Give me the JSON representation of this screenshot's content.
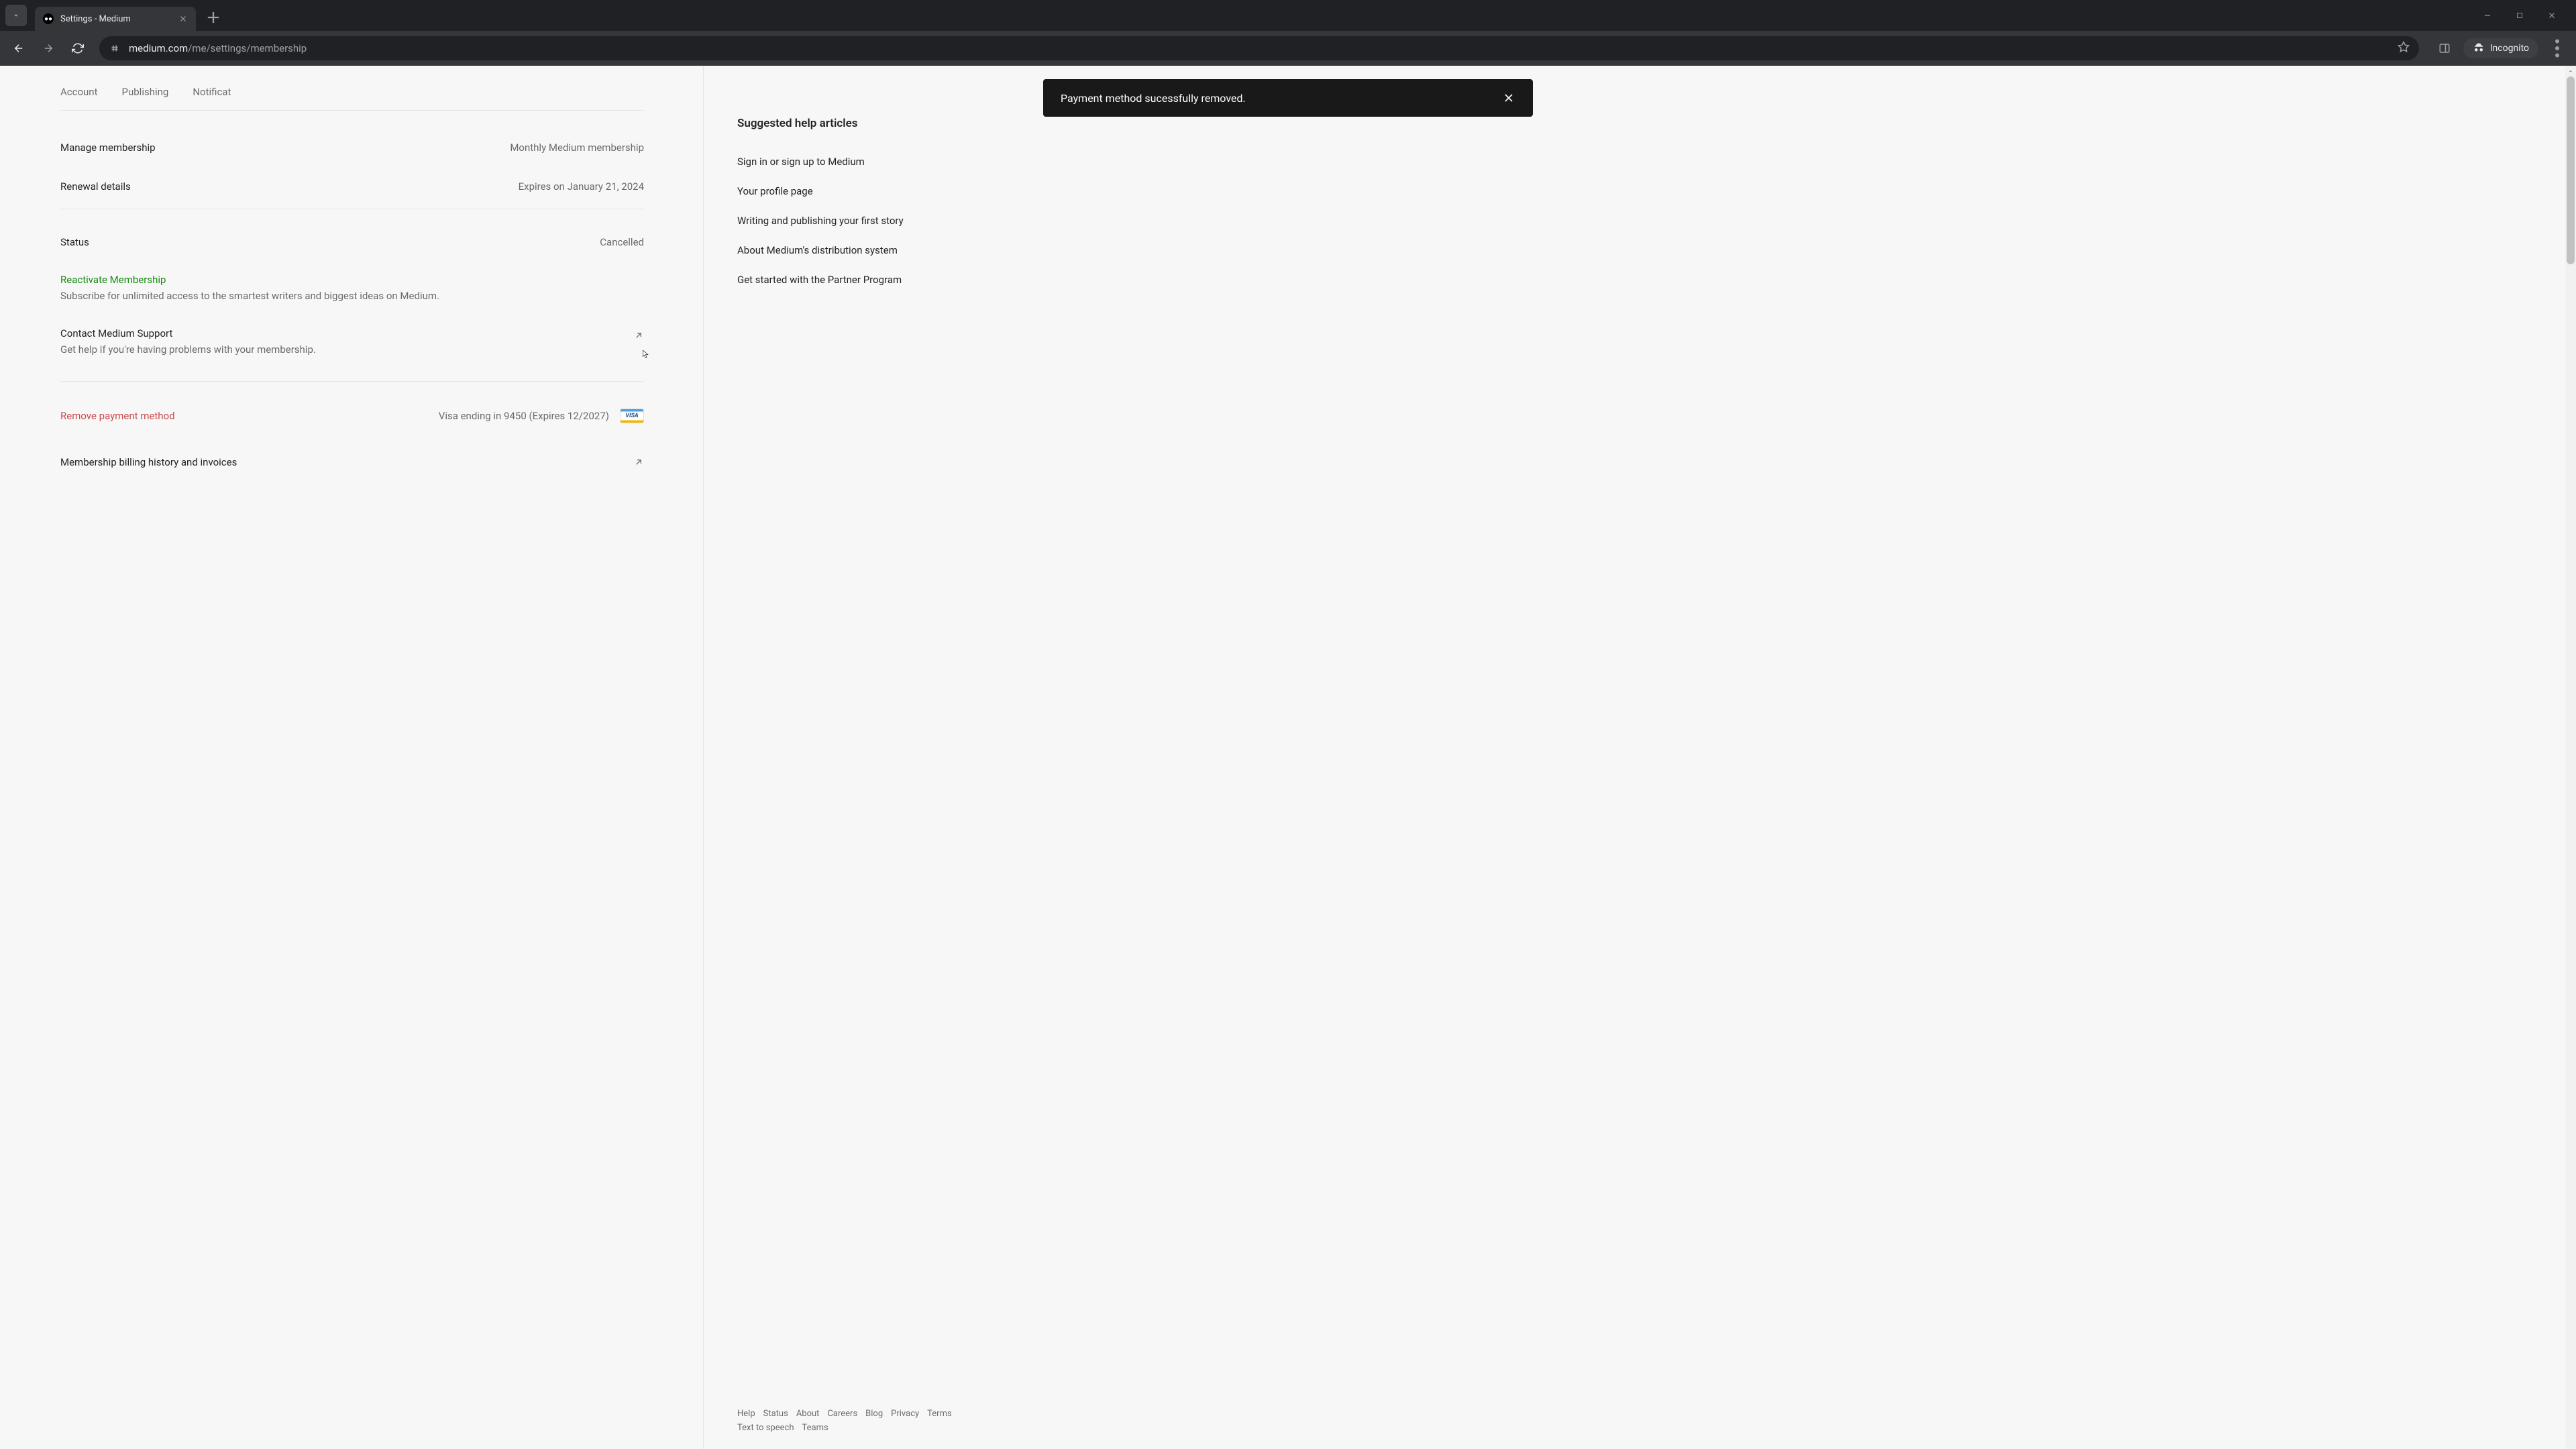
{
  "browser": {
    "tab_title": "Settings - Medium",
    "url_domain": "medium.com",
    "url_path": "/me/settings/membership",
    "incognito_label": "Incognito"
  },
  "toast": {
    "message": "Payment method sucessfully removed."
  },
  "tabs": {
    "account": "Account",
    "publishing": "Publishing",
    "notifications": "Notificat"
  },
  "rows": {
    "manage_label": "Manage membership",
    "manage_value": "Monthly Medium membership",
    "renewal_label": "Renewal details",
    "renewal_value": "Expires on January 21, 2024",
    "status_label": "Status",
    "status_value": "Cancelled",
    "reactivate_label": "Reactivate Membership",
    "reactivate_desc": "Subscribe for unlimited access to the smartest writers and biggest ideas on Medium.",
    "contact_label": "Contact Medium Support",
    "contact_desc": "Get help if you're having problems with your membership.",
    "remove_label": "Remove payment method",
    "payment_value": "Visa ending in 9450 (Expires 12/2027)",
    "visa_text": "VISA",
    "billing_label": "Membership billing history and invoices"
  },
  "sidebar": {
    "title": "Suggested help articles",
    "links": {
      "l1": "Sign in or sign up to Medium",
      "l2": "Your profile page",
      "l3": "Writing and publishing your first story",
      "l4": "About Medium's distribution system",
      "l5": "Get started with the Partner Program"
    }
  },
  "footer": {
    "f1": "Help",
    "f2": "Status",
    "f3": "About",
    "f4": "Careers",
    "f5": "Blog",
    "f6": "Privacy",
    "f7": "Terms",
    "f8": "Text to speech",
    "f9": "Teams"
  }
}
